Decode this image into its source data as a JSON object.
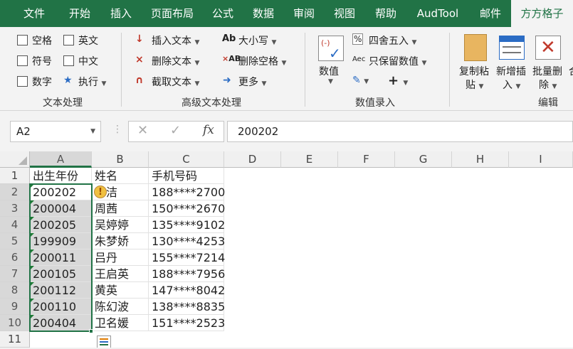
{
  "tabs": [
    "文件",
    "开始",
    "插入",
    "页面布局",
    "公式",
    "数据",
    "审阅",
    "视图",
    "帮助",
    "AudTool",
    "邮件",
    "方方格子"
  ],
  "ribbon": {
    "text_group": {
      "items": [
        "空格",
        "英文",
        "符号",
        "中文",
        "数字",
        "执行"
      ],
      "label": "文本处理"
    },
    "adv_group": {
      "items": [
        "插入文本",
        "删除文本",
        "截取文本",
        "大小写",
        "删除空格",
        "更多"
      ],
      "label": "高级文本处理"
    },
    "num_group": {
      "numeric": "数值",
      "round": "四舍五入",
      "keep_numeric": "只保留数值",
      "label": "数值录入"
    },
    "edit_group": {
      "copy_paste_1": "复制粘",
      "copy_paste_2": "贴",
      "add_insert_1": "新增插",
      "add_insert_2": "入",
      "batch_del_1": "批量删",
      "batch_del_2": "除",
      "more_char": "合",
      "label": "编辑"
    }
  },
  "formula_bar": {
    "name_box": "A2",
    "formula": "200202"
  },
  "sheet": {
    "columns": [
      "A",
      "B",
      "C",
      "D",
      "E",
      "F",
      "G",
      "H",
      "I"
    ],
    "rows": [
      "1",
      "2",
      "3",
      "4",
      "5",
      "6",
      "7",
      "8",
      "9",
      "10",
      "11"
    ],
    "data": [
      [
        "出生年份",
        "姓名",
        "手机号码"
      ],
      [
        "200202",
        "李洁",
        "188****2700"
      ],
      [
        "200004",
        "周茜",
        "150****2670"
      ],
      [
        "200205",
        "吴婷婷",
        "135****9102"
      ],
      [
        "199909",
        "朱梦娇",
        "130****4253"
      ],
      [
        "200011",
        "吕丹",
        "155****7214"
      ],
      [
        "200105",
        "王启英",
        "188****7956"
      ],
      [
        "200112",
        "黄英",
        "147****8042"
      ],
      [
        "200110",
        "陈幻波",
        "138****8835"
      ],
      [
        "200404",
        "卫名媛",
        "151****2523"
      ]
    ]
  },
  "colors": {
    "accent": "#217346",
    "selection": "#d8d8d8"
  }
}
